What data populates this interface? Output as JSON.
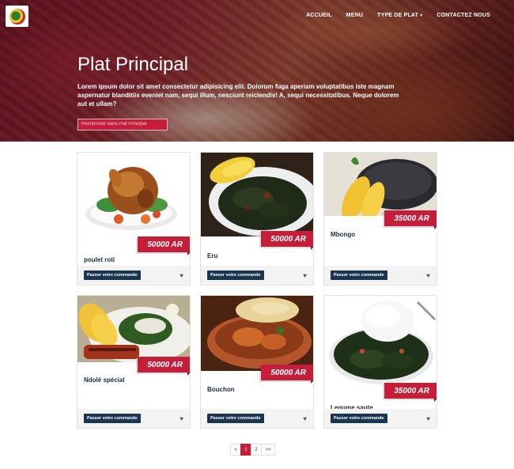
{
  "nav": {
    "items": [
      {
        "label": "ACCUEIL"
      },
      {
        "label": "MENU"
      },
      {
        "label": "TYPE DE PLAT",
        "has_dropdown": true
      },
      {
        "label": "CONTACTEZ NOUS"
      }
    ]
  },
  "hero": {
    "title": "Plat Principal",
    "text": "Lorem ipsum dolor sit amet consectetur adipisicing elit. Dolorum fuga aperiam voluptatibus iste magnam aspernatur blanditiis eveniet nam, sequi illum, nesciunt reiciendis! A, sequi necessitatibus. Neque dolorem aut et ullam?",
    "search_placeholder": "Rechercher dans Plat Principal"
  },
  "dishes": [
    {
      "name": "poulet roti",
      "price": "50000 AR"
    },
    {
      "name": "Eru",
      "price": "50000 AR"
    },
    {
      "name": "Mbongo",
      "price": "35000 AR"
    },
    {
      "name": "Ndolé spécial",
      "price": "50000 AR"
    },
    {
      "name": "Bouchon",
      "price": "50000 AR"
    },
    {
      "name": "Legume saute",
      "price": "35000 AR"
    }
  ],
  "card_button_label": "Passer votre commande",
  "pagination": {
    "prev": "«",
    "pages": [
      "1",
      "2"
    ],
    "next": ">>",
    "current": "1"
  },
  "colors": {
    "accent": "#c41e3a",
    "button": "#1a3550"
  }
}
